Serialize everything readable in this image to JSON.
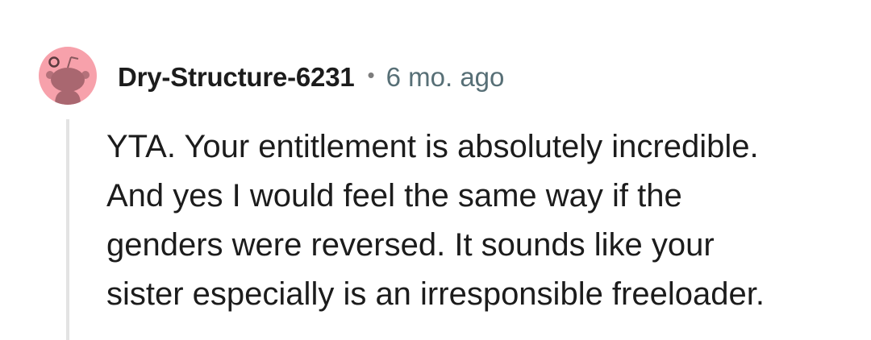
{
  "comment": {
    "username": "Dry-Structure-6231",
    "separator": "•",
    "timestamp": "6 mo. ago",
    "body_lines": [
      "YTA. Your entitlement is absolutely incredible.",
      "And yes I would feel the same way if the",
      "genders were reversed. It sounds like your",
      "sister especially is an irresponsible freeloader."
    ],
    "avatar_icon": "snoo-avatar-icon",
    "avatar_color": "#f7a1ab"
  }
}
